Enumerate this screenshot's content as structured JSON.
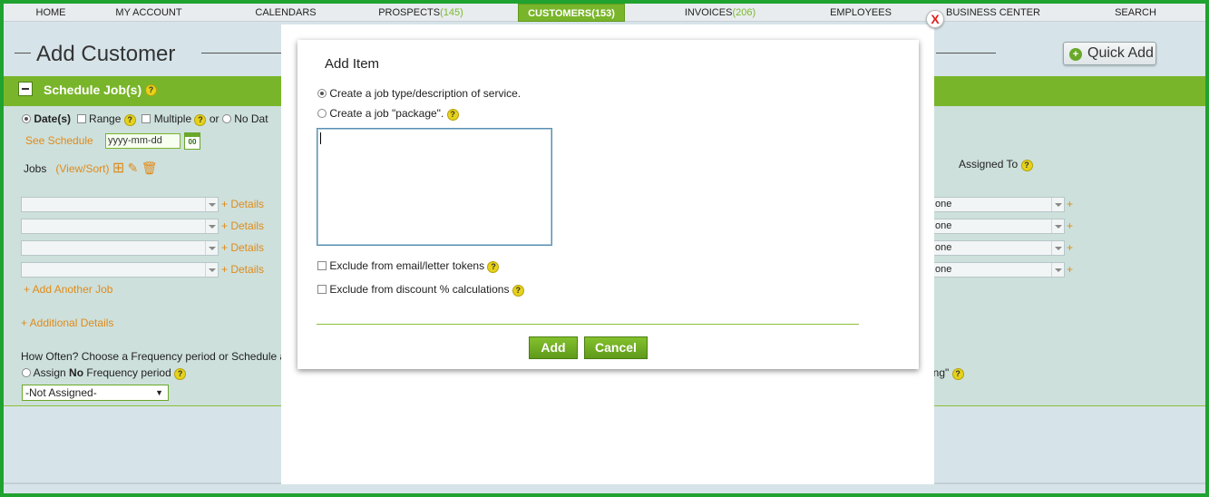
{
  "nav": {
    "items": [
      {
        "label": "HOME",
        "count": ""
      },
      {
        "label": "MY ACCOUNT",
        "count": ""
      },
      {
        "label": "CALENDARS",
        "count": ""
      },
      {
        "label": "PROSPECTS",
        "count": "(145)"
      },
      {
        "label": "CUSTOMERS",
        "count": "(153)"
      },
      {
        "label": "INVOICES",
        "count": "(206)"
      },
      {
        "label": "EMPLOYEES",
        "count": ""
      },
      {
        "label": "BUSINESS CENTER",
        "count": ""
      },
      {
        "label": "SEARCH",
        "count": ""
      }
    ],
    "active": "CUSTOMERS"
  },
  "page": {
    "title": "Add Customer",
    "quick_add": "Quick Add"
  },
  "schedule": {
    "title": "Schedule Job(s)",
    "date_option": "Date(s)",
    "range_option": "Range",
    "multiple_option": "Multiple",
    "or_text": "or",
    "no_date_option": "No Dat",
    "see_schedule": "See Schedule",
    "date_placeholder": "yyyy-mm-dd",
    "calendar_icon_text": "00",
    "jobs_label": "Jobs",
    "view_sort": "(View/Sort)",
    "assigned_to": "Assigned To",
    "details_label": "+ Details",
    "assignee_values": [
      "one",
      "one",
      "one",
      "one"
    ],
    "plus": "+",
    "add_another_job": "+ Add Another Job",
    "additional_details": "+ Additional Details",
    "how_often": "How Often? Choose a Frequency period or Schedule a",
    "assign_no_freq_prefix": "Assign ",
    "assign_no_freq_bold": "No",
    "assign_no_freq_suffix": " Frequency period",
    "not_assigned": "-Not Assigned-",
    "ing_text": "ing\""
  },
  "modal": {
    "title": "Add Item",
    "option1": "Create a job type/description of service.",
    "option2": "Create a job \"package\".",
    "textarea_value": "",
    "exclude_email": "Exclude from email/letter tokens",
    "exclude_discount": "Exclude from discount % calculations",
    "add_button": "Add",
    "cancel_button": "Cancel",
    "close": "X"
  },
  "colors": {
    "accent_green": "#79b52a",
    "border_green": "#1fa22f",
    "link_orange": "#e08b19",
    "close_red": "#e02020"
  }
}
